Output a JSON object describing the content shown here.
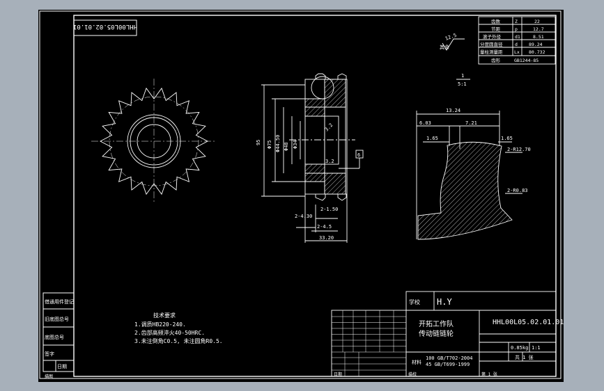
{
  "drawing_number_rotated": "HHL00L05.02.01.01",
  "params": {
    "rows": [
      {
        "name": "齿数",
        "symbol": "Z",
        "value": "22"
      },
      {
        "name": "节距",
        "symbol": "p",
        "value": "12.7"
      },
      {
        "name": "滚子外径",
        "symbol": "d1",
        "value": "8.51"
      },
      {
        "name": "分度圆直径",
        "symbol": "d",
        "value": "89.24"
      },
      {
        "name": "量柱测量距",
        "symbol": "Lx",
        "value": "80.732"
      },
      {
        "name": "齿形",
        "symbol": "",
        "value": "GB1244-85"
      }
    ]
  },
  "roughness": {
    "value": "12.5",
    "note": "其余"
  },
  "detail_scale": {
    "number": "1",
    "scale": "5:1"
  },
  "section_dims": {
    "d75": "Φ75",
    "d4450": "Φ44.50",
    "d48": "Φ48",
    "d34": "Φ34",
    "d95": "95",
    "r32": "3.2",
    "c430": "2-4.30",
    "c150": "2-1.50",
    "c45": "2-4.5",
    "w3320": "33.20",
    "r_1": "3.2",
    "r_2": "3.2",
    "flag": "6"
  },
  "detail_dims": {
    "d1324": "13.24",
    "d603": "6.03",
    "d721": "7.21",
    "d165a": "1.65",
    "d165b": "1.65",
    "r1270": "2-R12.70",
    "r083": "2-R0.83"
  },
  "tech_req": {
    "title": "技术要求",
    "items": [
      "1.调质HB220-240.",
      "2.齿部高频淬火40-50HRC.",
      "3.未注倒角C0.5, 未注圆角R0.5."
    ]
  },
  "title_block": {
    "company": "H.Y",
    "company_label": "学校",
    "part_name_line1": "开拓工作队",
    "part_name_line2": "传动链链轮",
    "drawing_number": "HHL00L05.02.01.01",
    "standard1": "100  GB/T702-2004",
    "standard2": "45   GB/T699-1999",
    "material_label": "材料",
    "weight": "0.85kg",
    "scale": "1:1",
    "sheet": "共 1 张",
    "label_sheet": "第 1 张"
  },
  "side_labels": [
    "借通用件登记",
    "旧底图总号",
    "底图总号",
    "签字",
    "日期"
  ],
  "bottom_labels": [
    "描图",
    "描校",
    "日期"
  ]
}
